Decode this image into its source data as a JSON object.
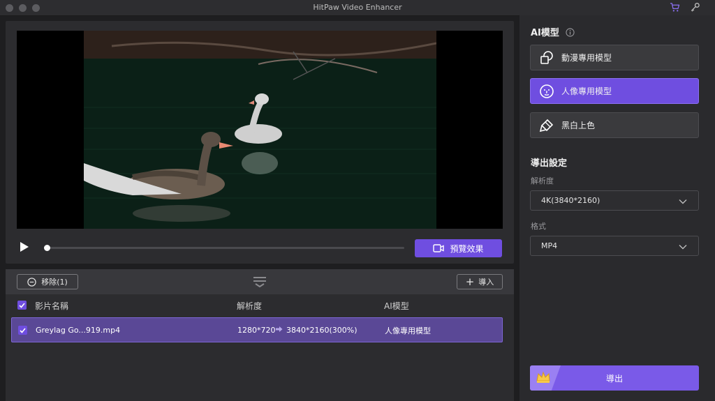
{
  "window": {
    "title": "HitPaw Video Enhancer"
  },
  "preview": {
    "preview_button_label": "預覽效果",
    "progress": 0
  },
  "list": {
    "remove_label": "移除(1)",
    "import_label": "導入",
    "headers": {
      "name": "影片名稱",
      "resolution": "解析度",
      "model": "AI模型"
    },
    "rows": [
      {
        "name": "Greylag Go...919.mp4",
        "source_res": "1280*720",
        "target_res": "3840*2160(300%)",
        "model": "人像專用模型",
        "checked": true
      }
    ]
  },
  "sidebar": {
    "ai_model_title": "AI模型",
    "models": [
      {
        "label": "動漫專用模型",
        "icon": "anime-icon",
        "active": false
      },
      {
        "label": "人像專用模型",
        "icon": "face-icon",
        "active": true
      },
      {
        "label": "黑白上色",
        "icon": "colorize-icon",
        "active": false
      }
    ],
    "export_settings_title": "導出設定",
    "resolution_label": "解析度",
    "resolution_value": "4K(3840*2160)",
    "format_label": "格式",
    "format_value": "MP4",
    "export_label": "導出"
  },
  "colors": {
    "accent": "#6f4ee0",
    "selected_row": "#5a4896",
    "panel": "#2c2c2f"
  }
}
